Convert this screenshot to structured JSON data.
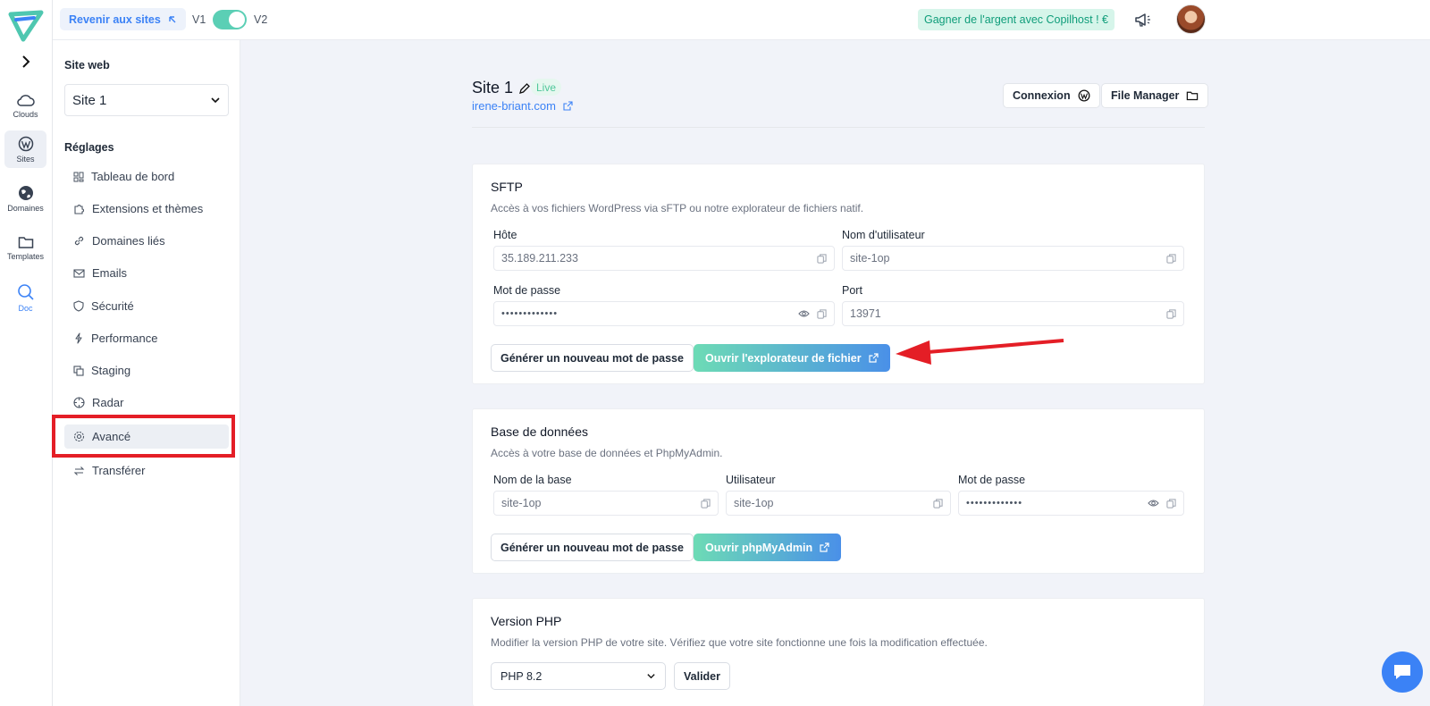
{
  "topbar": {
    "back_label": "Revenir aux sites",
    "v1": "V1",
    "v2": "V2",
    "earn_label": "Gagner de l'argent avec Copilhost ! €"
  },
  "rail": {
    "items": [
      "Clouds",
      "Sites",
      "Domaines",
      "Templates",
      "Doc"
    ],
    "active": "Sites"
  },
  "sidebar": {
    "website_heading": "Site web",
    "selected_site": "Site 1",
    "settings_heading": "Réglages",
    "items": [
      {
        "label": "Tableau de bord",
        "icon": "dashboard-icon"
      },
      {
        "label": "Extensions et thèmes",
        "icon": "puzzle-icon"
      },
      {
        "label": "Domaines liés",
        "icon": "link-icon"
      },
      {
        "label": "Emails",
        "icon": "mail-icon"
      },
      {
        "label": "Sécurité",
        "icon": "shield-icon"
      },
      {
        "label": "Performance",
        "icon": "bolt-icon"
      },
      {
        "label": "Staging",
        "icon": "copy-icon"
      },
      {
        "label": "Radar",
        "icon": "radar-icon"
      },
      {
        "label": "Avancé",
        "icon": "gear-icon"
      },
      {
        "label": "Transférer",
        "icon": "transfer-icon"
      }
    ],
    "active_item": "Avancé"
  },
  "header": {
    "site_name": "Site 1",
    "status": "Live",
    "site_url": "irene-briant.com",
    "connexion_label": "Connexion",
    "file_manager_label": "File Manager"
  },
  "sftp": {
    "title": "SFTP",
    "description": "Accès à vos fichiers WordPress via sFTP ou notre explorateur de fichiers natif.",
    "host_label": "Hôte",
    "host_value": "35.189.211.233",
    "user_label": "Nom d'utilisateur",
    "user_value": "site-1op",
    "password_label": "Mot de passe",
    "password_value": "•••••••••••••",
    "port_label": "Port",
    "port_value": "13971",
    "new_password_button": "Générer un nouveau mot de passe",
    "open_explorer_button": "Ouvrir l'explorateur de fichier"
  },
  "database": {
    "title": "Base de données",
    "description": "Accès à votre base de données et PhpMyAdmin.",
    "name_label": "Nom de la base",
    "name_value": "site-1op",
    "user_label": "Utilisateur",
    "user_value": "site-1op",
    "password_label": "Mot de passe",
    "password_value": "•••••••••••••",
    "new_password_button": "Générer un nouveau mot de passe",
    "open_pma_button": "Ouvrir phpMyAdmin"
  },
  "php": {
    "title": "Version PHP",
    "description": "Modifier la version PHP de votre site. Vérifiez que votre site fonctionne une fois la modification effectuée.",
    "selected_version": "PHP 8.2",
    "validate_button": "Valider"
  },
  "colors": {
    "accent_blue": "#3b82f6",
    "accent_green": "#5bcfb5",
    "annotation_red": "#e41e26"
  }
}
